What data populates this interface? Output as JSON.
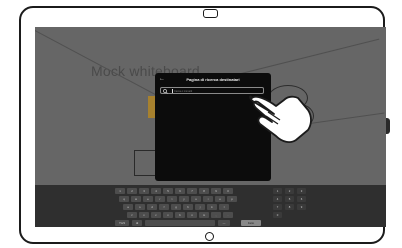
{
  "whiteboard": {
    "title": "Mock whiteboard"
  },
  "panel": {
    "back_glyph": "←",
    "title": "Pagina di ricerca destinatari",
    "search_placeholder": "Cerca o immetti"
  },
  "keyboard": {
    "rows": [
      [
        "1",
        "2",
        "3",
        "4",
        "5",
        "6",
        "7",
        "8",
        "9",
        "0"
      ],
      [
        "q",
        "w",
        "e",
        "r",
        "t",
        "y",
        "u",
        "i",
        "o",
        "p"
      ],
      [
        "a",
        "s",
        "d",
        "f",
        "g",
        "h",
        "j",
        "k",
        "l"
      ],
      [
        "z",
        "x",
        "c",
        "v",
        "b",
        "n",
        "m",
        ",",
        "."
      ]
    ],
    "numpad": [
      "1",
      "2",
      "3",
      "4",
      "5",
      "6",
      "7",
      "8",
      "9",
      "0"
    ],
    "bottom_row": {
      "symbols": "?123",
      "globe": "⊕",
      "space": "",
      "dash": "—",
      "done": "Fatto"
    }
  },
  "colors": {
    "screen_bg": "#666666",
    "panel_bg": "#0c0c0c",
    "keyboard_bg": "#2f2f2f",
    "accent_yellow": "#a7812e"
  }
}
